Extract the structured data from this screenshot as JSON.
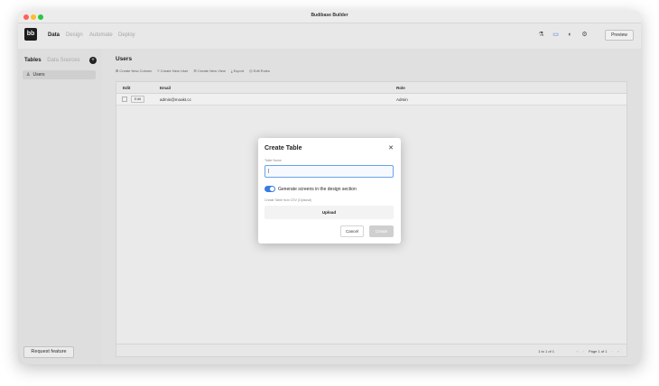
{
  "window": {
    "title": "Budibase Builder"
  },
  "topnav": {
    "logo": "bb",
    "tabs": [
      {
        "label": "Data"
      },
      {
        "label": "Design"
      },
      {
        "label": "Automate"
      },
      {
        "label": "Deploy"
      }
    ],
    "icons": [
      "paint-icon",
      "chat-icon",
      "github-icon",
      "settings-icon"
    ],
    "preview_label": "Preview"
  },
  "sidebar": {
    "tabs": [
      {
        "label": "Tables"
      },
      {
        "label": "Data Sources"
      }
    ],
    "items": [
      {
        "label": "Users"
      }
    ],
    "request_feature": "Request feature"
  },
  "main": {
    "title": "Users",
    "toolbar": [
      {
        "label": "Create New Column"
      },
      {
        "label": "Create New User"
      },
      {
        "label": "Create New View"
      },
      {
        "label": "Export"
      },
      {
        "label": "Edit Roles"
      }
    ],
    "table": {
      "columns": [
        "Edit",
        "Email",
        "Role"
      ],
      "rows": [
        {
          "edit": "Edit",
          "email": "admin@moakt.cc",
          "role": "Admin"
        }
      ],
      "row_count": "1 to 1 of 1",
      "page_info": "Page 1 of 1"
    }
  },
  "modal": {
    "title": "Create Table",
    "table_name_label": "Table Name",
    "table_name_value": "|",
    "toggle_label": "Generate screens in the design section",
    "csv_label": "Create Table from CSV (Optional)",
    "upload_label": "Upload",
    "cancel_label": "Cancel",
    "create_label": "Create"
  },
  "colors": {
    "accent": "#3a7de0",
    "dark": "#1f1f1f"
  }
}
